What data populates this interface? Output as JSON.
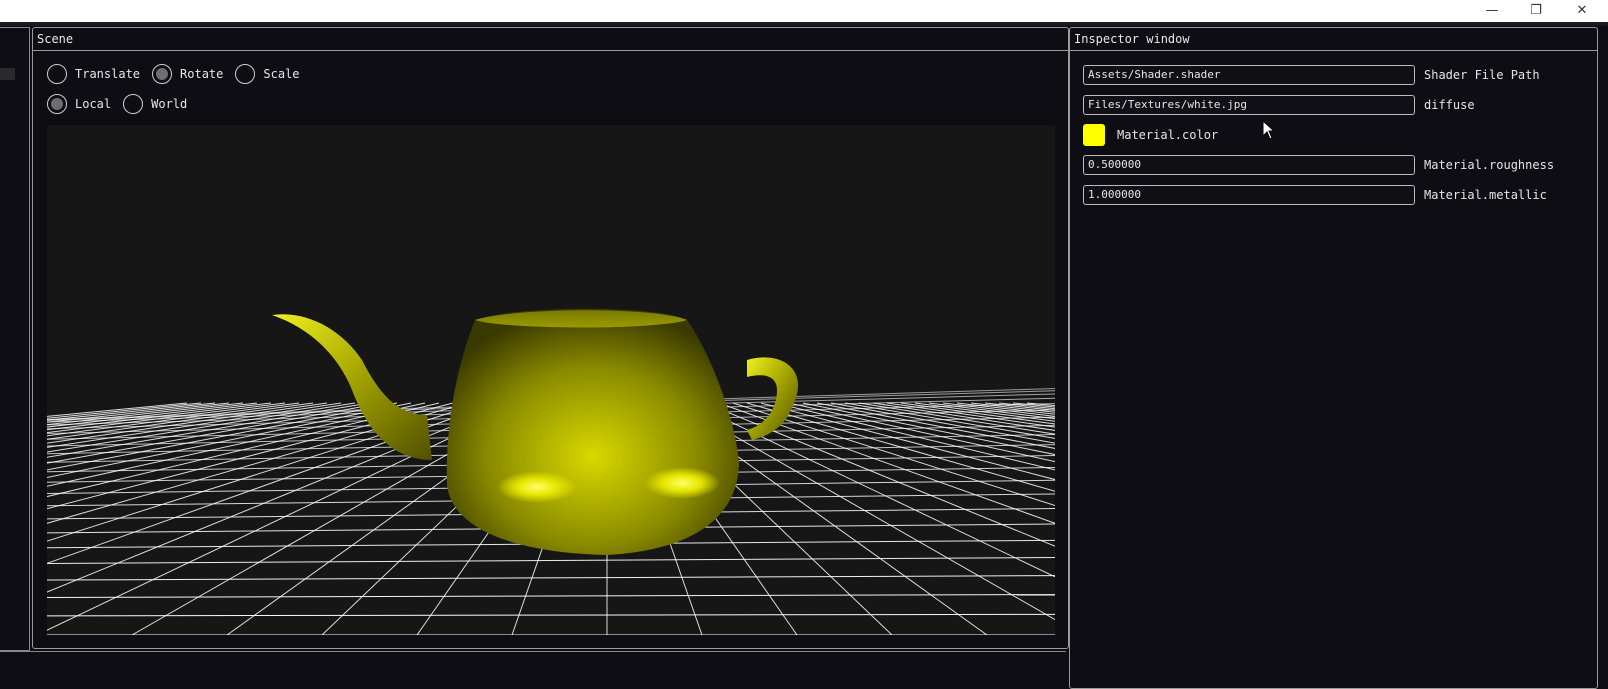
{
  "window": {
    "minimize_glyph": "—",
    "maximize_glyph": "❐",
    "close_glyph": "✕"
  },
  "scene": {
    "title": "Scene",
    "operations": [
      {
        "label": "Translate",
        "selected": false
      },
      {
        "label": "Rotate",
        "selected": true
      },
      {
        "label": "Scale",
        "selected": false
      }
    ],
    "spaces": [
      {
        "label": "Local",
        "selected": true
      },
      {
        "label": "World",
        "selected": false
      }
    ],
    "viewport": {
      "background": "#161616",
      "object": "teapot",
      "object_color": "#d8d800",
      "grid_color": "#ffffff"
    }
  },
  "inspector": {
    "title": "Inspector window",
    "shader_path": {
      "value": "Assets/Shader.shader",
      "label": "Shader File Path"
    },
    "diffuse": {
      "value": "Files/Textures/white.jpg",
      "label": "diffuse"
    },
    "color": {
      "swatch": "#ffff00",
      "label": "Material.color"
    },
    "roughness": {
      "value": "0.500000",
      "label": "Material.roughness"
    },
    "metallic": {
      "value": "1.000000",
      "label": "Material.metallic"
    }
  }
}
